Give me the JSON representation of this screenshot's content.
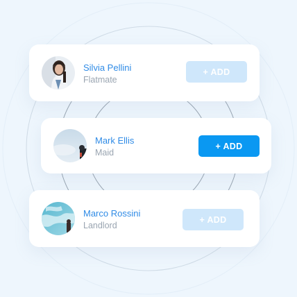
{
  "contacts": [
    {
      "name": "Silvia Pellini",
      "role": "Flatmate",
      "button_label": "+ ADD",
      "state": "faded",
      "avatar": "woman-portrait-photo"
    },
    {
      "name": "Mark Ellis",
      "role": "Maid",
      "button_label": "+ ADD",
      "state": "active",
      "avatar": "sky-figure-photo"
    },
    {
      "name": "Marco Rossini",
      "role": "Landlord",
      "button_label": "+ ADD",
      "state": "faded",
      "avatar": "beach-figure-photo"
    }
  ],
  "colors": {
    "background": "#eef6fd",
    "accent": "#0a98f2",
    "accent_faded": "#cfe7fb",
    "name_text": "#2f8be6",
    "role_text": "#9aa5b1"
  }
}
